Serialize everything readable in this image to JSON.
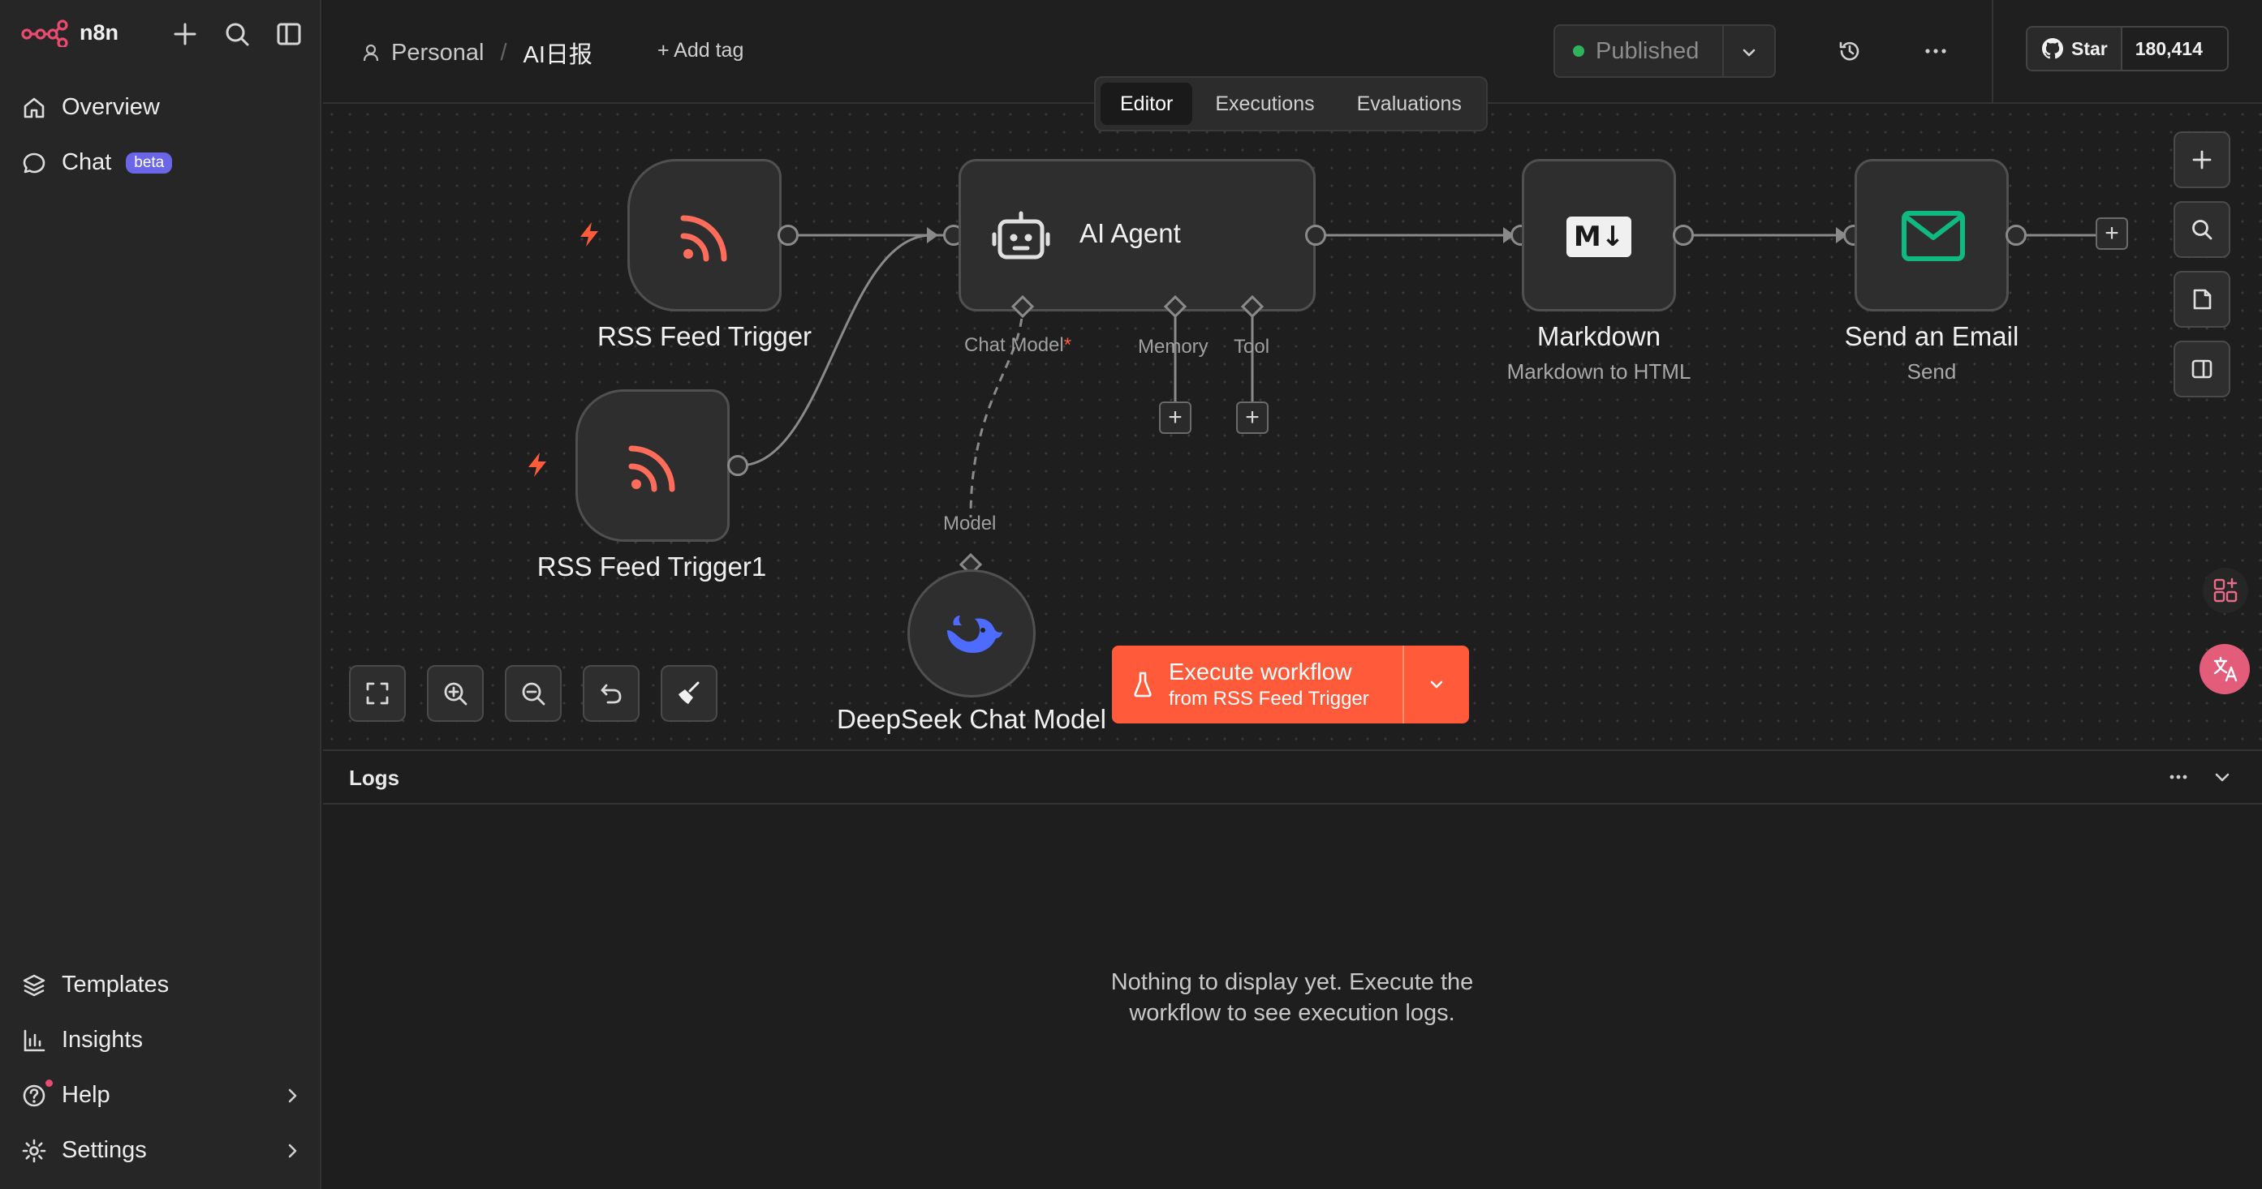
{
  "app": {
    "name": "n8n"
  },
  "sidebar": {
    "nav": [
      {
        "label": "Overview"
      },
      {
        "label": "Chat",
        "badge": "beta"
      }
    ],
    "bottom": [
      {
        "label": "Templates"
      },
      {
        "label": "Insights"
      },
      {
        "label": "Help"
      },
      {
        "label": "Settings"
      }
    ]
  },
  "header": {
    "breadcrumb_project": "Personal",
    "breadcrumb_sep": "/",
    "workflow_name": "AI日报",
    "add_tag": "+ Add tag",
    "publish_status": "Published",
    "github_star": "Star",
    "github_count": "180,414"
  },
  "tabs": [
    {
      "label": "Editor",
      "active": true
    },
    {
      "label": "Executions"
    },
    {
      "label": "Evaluations"
    }
  ],
  "nodes": {
    "rss1": {
      "label": "RSS Feed Trigger"
    },
    "rss2": {
      "label": "RSS Feed Trigger1"
    },
    "agent": {
      "label": "AI Agent",
      "port_chat_model": "Chat Model",
      "required_mark": "*",
      "port_memory": "Memory",
      "port_tool": "Tool"
    },
    "markdown": {
      "label": "Markdown",
      "sub": "Markdown to HTML",
      "icon_text": "M↓"
    },
    "email": {
      "label": "Send an Email",
      "sub": "Send"
    },
    "deepseek": {
      "label": "DeepSeek Chat Model",
      "port_model": "Model"
    }
  },
  "execute": {
    "title": "Execute workflow",
    "subtitle": "from RSS Feed Trigger"
  },
  "logs": {
    "title": "Logs",
    "empty_line1": "Nothing to display yet. Execute the",
    "empty_line2": "workflow to see execution logs."
  },
  "colors": {
    "accent": "#ff5b3a",
    "rss": "#ff6d5a",
    "email": "#10b981",
    "deepseek": "#4d6bfe",
    "published_dot": "#2fb35a"
  }
}
